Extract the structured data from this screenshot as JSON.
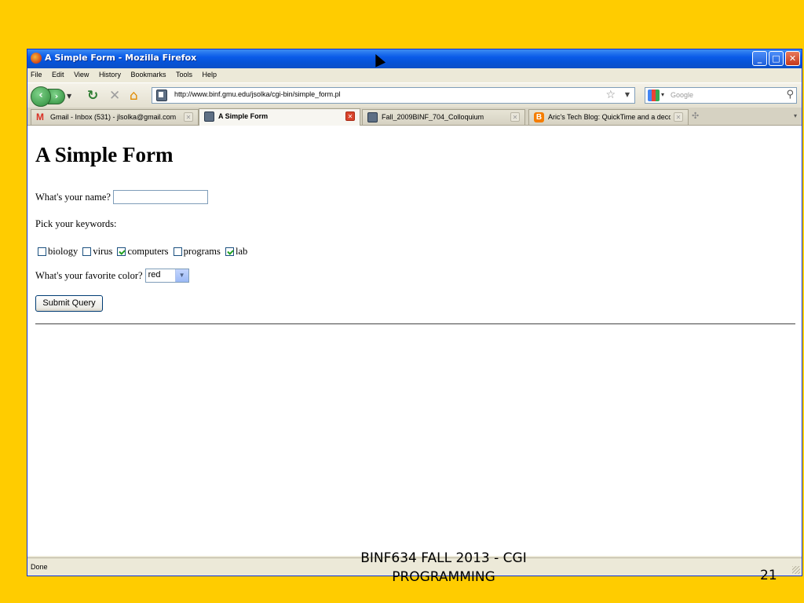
{
  "window": {
    "title": "A Simple Form - Mozilla Firefox",
    "buttons": {
      "minimize": "_",
      "maximize": "□",
      "close": "✕"
    }
  },
  "menu": [
    "File",
    "Edit",
    "View",
    "History",
    "Bookmarks",
    "Tools",
    "Help"
  ],
  "nav": {
    "url": "http://www.binf.gmu.edu/jsolka/cgi-bin/simple_form.pl",
    "search_placeholder": "Google",
    "icons": [
      "back-icon",
      "forward-icon",
      "reload-icon",
      "stop-icon",
      "home-icon",
      "bookmark-star-icon",
      "search-icon"
    ]
  },
  "tabs": [
    {
      "label": "Gmail - Inbox (531) - jlsolka@gmail.com",
      "icon": "gmail-icon",
      "active": false
    },
    {
      "label": "A Simple Form",
      "icon": "page-icon",
      "active": true
    },
    {
      "label": "Fall_2009BINF_704_Colloquium",
      "icon": "page-icon",
      "active": false
    },
    {
      "label": "Aric's Tech Blog: QuickTime and a deco...",
      "icon": "blogger-icon",
      "active": false
    }
  ],
  "page": {
    "heading": "A Simple Form",
    "name_label": "What's your name?",
    "name_value": "",
    "keywords_label": "Pick your keywords:",
    "keywords": [
      {
        "label": "biology",
        "checked": false
      },
      {
        "label": "virus",
        "checked": false
      },
      {
        "label": "computers",
        "checked": true
      },
      {
        "label": "programs",
        "checked": false
      },
      {
        "label": "lab",
        "checked": true
      }
    ],
    "color_label": "What's your favorite color?",
    "color_value": "red",
    "submit_label": "Submit Query"
  },
  "status": {
    "text": "Done"
  },
  "slide": {
    "footer_line1": "BINF634 FALL 2013 - CGI",
    "footer_line2": "PROGRAMMING",
    "number": "21"
  }
}
